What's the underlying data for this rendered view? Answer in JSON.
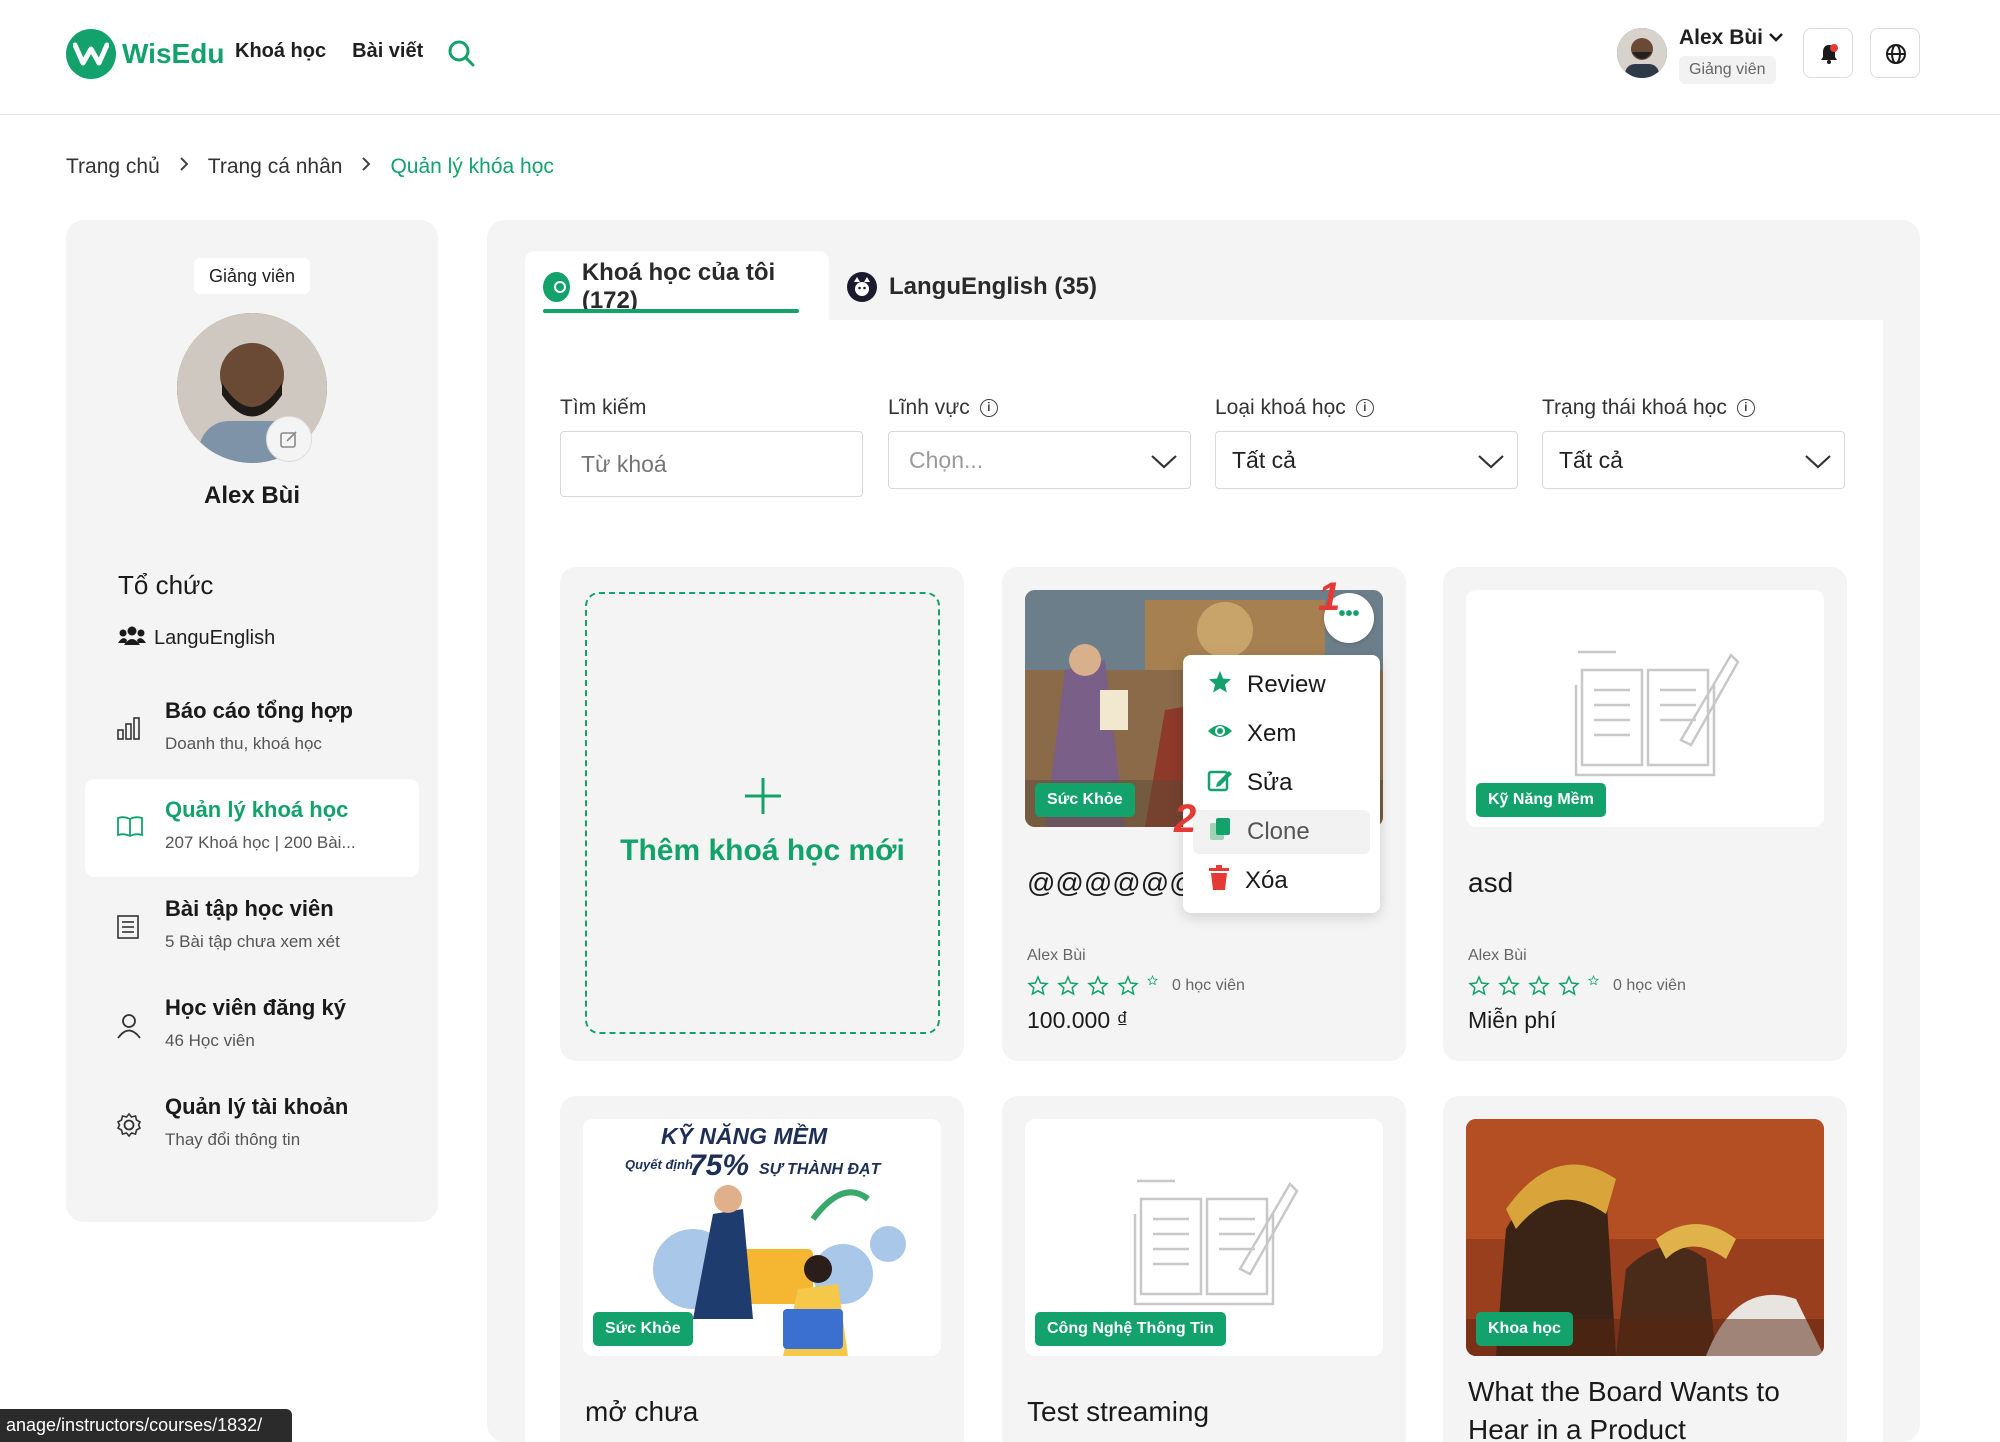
{
  "header": {
    "logo_text": "WisEdu",
    "nav": [
      "Khoá học",
      "Bài viết"
    ],
    "user_name": "Alex Bùi",
    "user_role": "Giảng viên"
  },
  "breadcrumb": [
    "Trang chủ",
    "Trang cá nhân",
    "Quản lý khóa học"
  ],
  "sidebar": {
    "role": "Giảng viên",
    "name": "Alex Bùi",
    "org_title": "Tổ chức",
    "org_name": "LanguEnglish",
    "menu": [
      {
        "title": "Báo cáo tổng hợp",
        "sub": "Doanh thu, khoá học"
      },
      {
        "title": "Quản lý khoá học",
        "sub": "207 Khoá học | 200 Bài..."
      },
      {
        "title": "Bài tập học viên",
        "sub": "5 Bài tập chưa xem xét"
      },
      {
        "title": "Học viên đăng ký",
        "sub": "46 Học viên"
      },
      {
        "title": "Quản lý tài khoản",
        "sub": "Thay đổi thông tin"
      }
    ]
  },
  "tabs": [
    {
      "label": "Khoá học của tôi (172)"
    },
    {
      "label": "LanguEnglish (35)"
    }
  ],
  "filters": {
    "search": {
      "label": "Tìm kiếm",
      "placeholder": "Từ khoá"
    },
    "field": {
      "label": "Lĩnh vực",
      "value": "Chọn..."
    },
    "type": {
      "label": "Loại khoá học",
      "value": "Tất cả"
    },
    "status": {
      "label": "Trạng thái khoá học",
      "value": "Tất cả"
    }
  },
  "add_course": "Thêm khoá học mới",
  "courses": [
    {
      "title": "@@@@@@",
      "tag": "Sức Khỏe",
      "author": "Alex Bùi",
      "students": "0 học viên",
      "price": "100.000 ₫"
    },
    {
      "title": "asd",
      "tag": "Kỹ Năng Mềm",
      "author": "Alex Bùi",
      "students": "0 học viên",
      "price": "Miễn phí"
    },
    {
      "title": "mở chưa",
      "tag": "Sức Khỏe",
      "poster_title": "KỸ NĂNG MỀM",
      "poster_sub": "Quyết định",
      "poster_pct": "75%",
      "poster_tail": "SỰ THÀNH ĐẠT"
    },
    {
      "title": "Test streaming",
      "tag": "Công Nghệ Thông Tin"
    },
    {
      "title": "What the Board Wants to",
      "title2": "Hear in a Product",
      "tag": "Khoa học"
    }
  ],
  "markers": [
    "1",
    "2"
  ],
  "context_menu": [
    "Review",
    "Xem",
    "Sửa",
    "Clone",
    "Xóa"
  ],
  "status_url": "anage/instructors/courses/1832/",
  "colors": {
    "accent": "#13a26b",
    "danger": "#e53935"
  }
}
